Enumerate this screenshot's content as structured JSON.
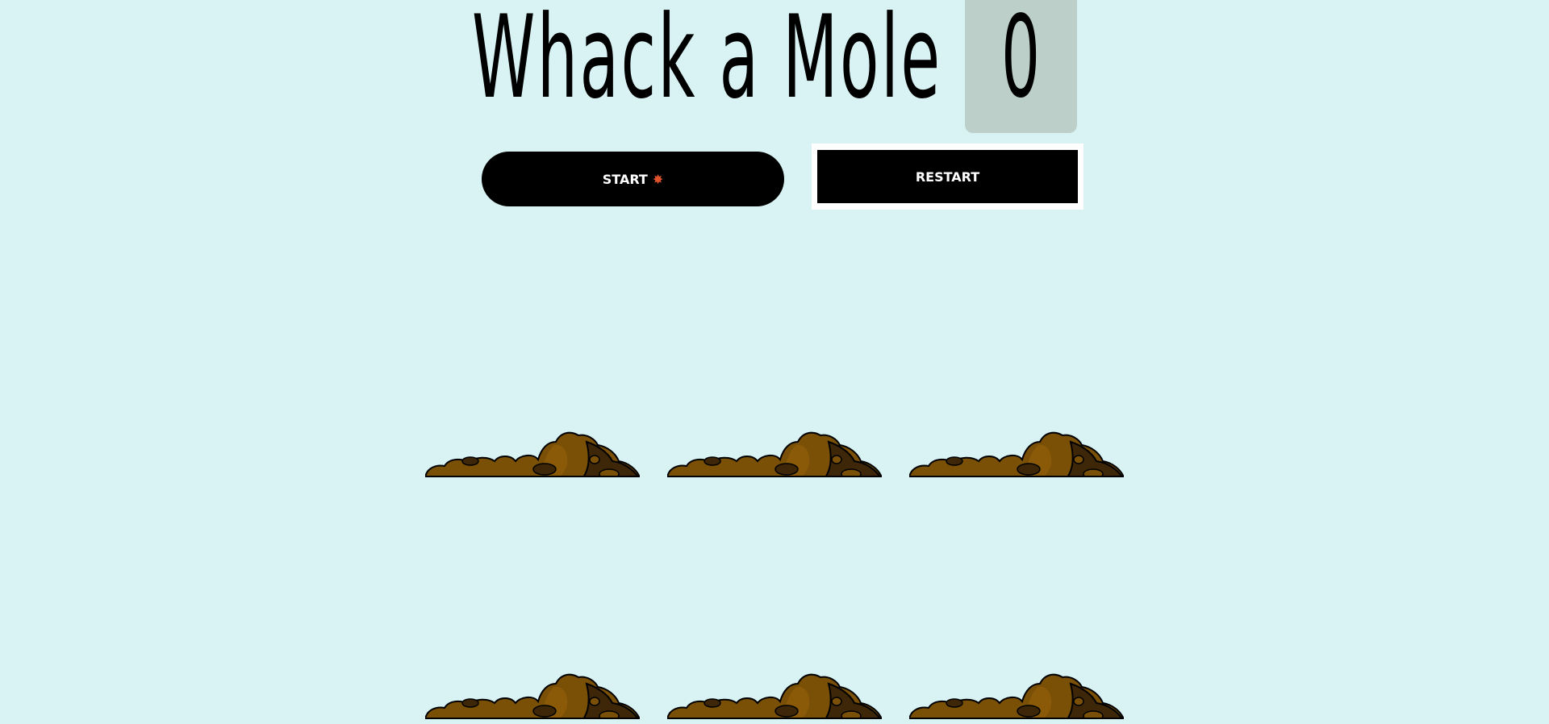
{
  "game": {
    "title": "Whack a Mole",
    "score": "0"
  },
  "controls": {
    "start_label": "START",
    "start_icon": "✸",
    "restart_label": "RESTART"
  },
  "board": {
    "holes": [
      {
        "name": "hole-1"
      },
      {
        "name": "hole-2"
      },
      {
        "name": "hole-3"
      },
      {
        "name": "hole-4"
      },
      {
        "name": "hole-5"
      },
      {
        "name": "hole-6"
      }
    ]
  },
  "colors": {
    "background": "#d9f3f4",
    "score_box": "#bccfc9",
    "dirt_light": "#7a4f06",
    "dirt_dark": "#3e2708",
    "accent_spark": "#e0522a"
  }
}
